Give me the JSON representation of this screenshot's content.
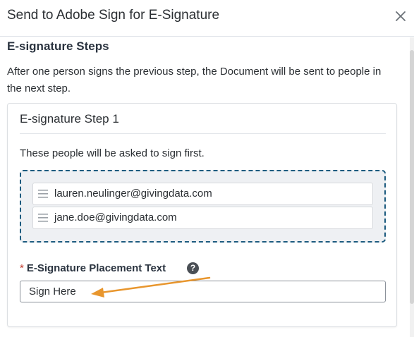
{
  "modal": {
    "title": "Send to Adobe Sign for E-Signature",
    "close_icon": "close-icon"
  },
  "section": {
    "heading": "E-signature Steps",
    "description": "After one person signs the previous step, the Document will be sent to people in the next step."
  },
  "step": {
    "title": "E-signature Step 1",
    "description": "These people will be asked to sign first.",
    "signers": [
      {
        "email": "lauren.neulinger@givingdata.com",
        "icon": "drag-handle-icon"
      },
      {
        "email": "jane.doe@givingdata.com",
        "icon": "drag-handle-icon"
      }
    ]
  },
  "placement_field": {
    "required_mark": "*",
    "label": "E-Signature Placement Text",
    "help_icon": "help-icon",
    "help_glyph": "?",
    "value": "Sign Here"
  },
  "annotation": {
    "arrow_color": "#e8962e"
  }
}
